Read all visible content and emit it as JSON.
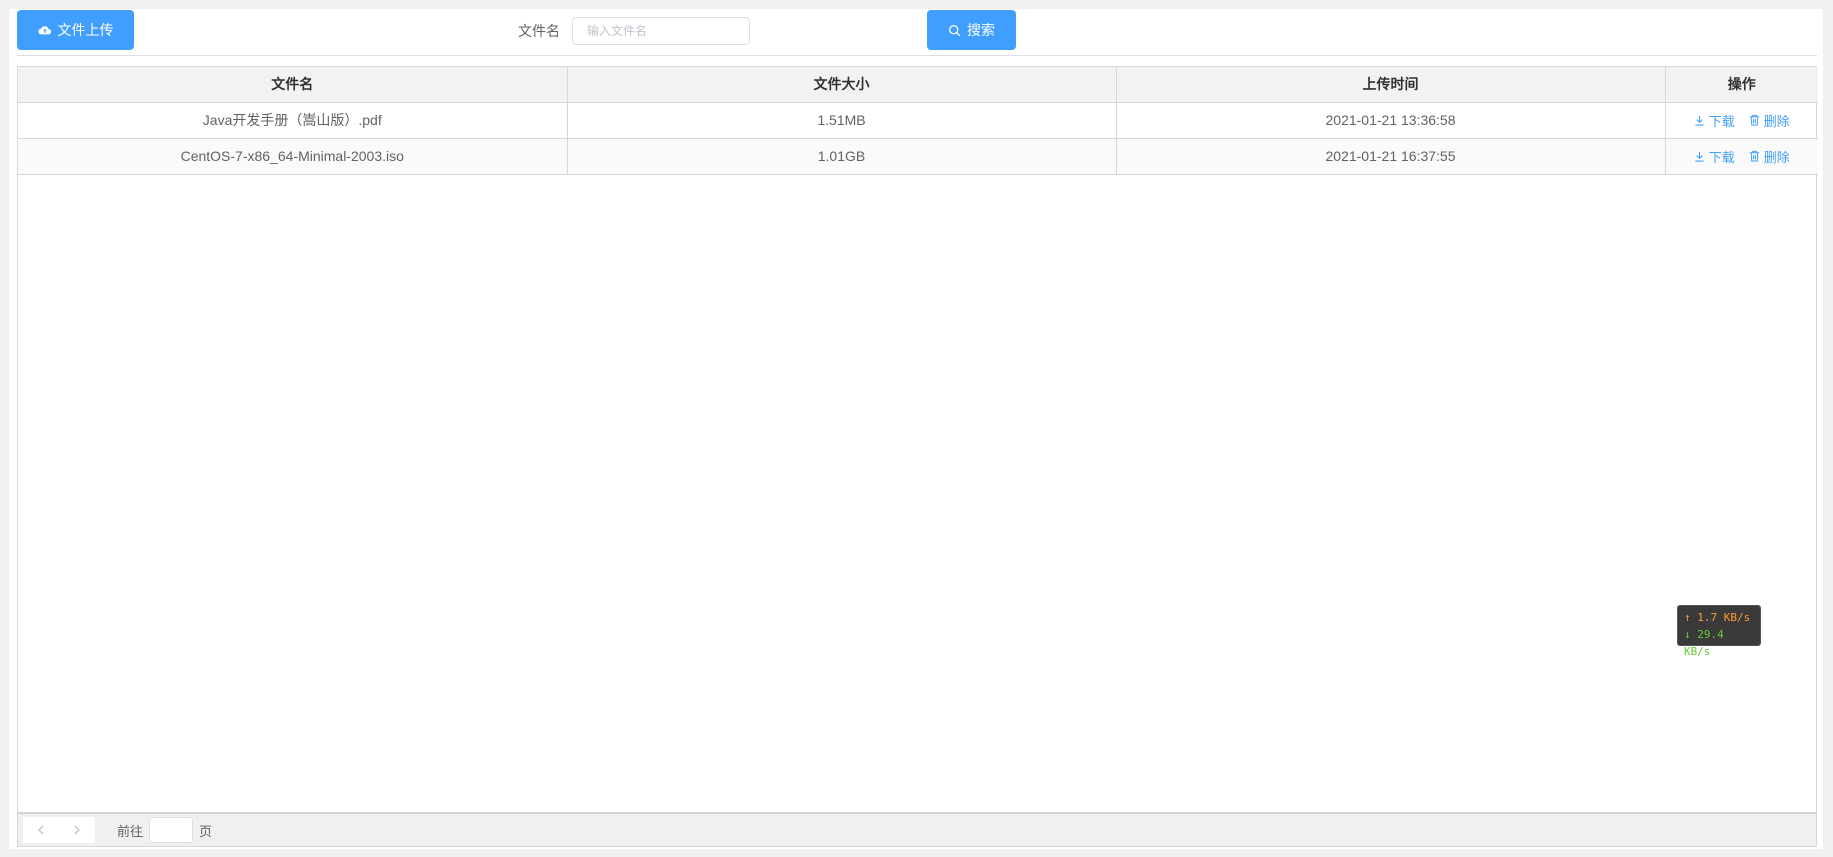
{
  "toolbar": {
    "upload_label": "文件上传",
    "filter_label": "文件名",
    "filter_placeholder": "输入文件名",
    "filter_value": "",
    "search_label": "搜索"
  },
  "table": {
    "columns": [
      "文件名",
      "文件大小",
      "上传时间",
      "操作"
    ],
    "rows": [
      {
        "name": "Java开发手册（嵩山版）.pdf",
        "size": "1.51MB",
        "time": "2021-01-21 13:36:58",
        "download": "下载",
        "delete": "删除"
      },
      {
        "name": "CentOS-7-x86_64-Minimal-2003.iso",
        "size": "1.01GB",
        "time": "2021-01-21 16:37:55",
        "download": "下载",
        "delete": "删除"
      }
    ]
  },
  "pager": {
    "goto_label": "前往",
    "page_value": "",
    "page_suffix": "页"
  },
  "speed": {
    "upload": "1.7 KB/s",
    "download": "29.4 KB/s"
  },
  "colors": {
    "primary": "#409eff",
    "header_bg": "#f2f2f2"
  }
}
